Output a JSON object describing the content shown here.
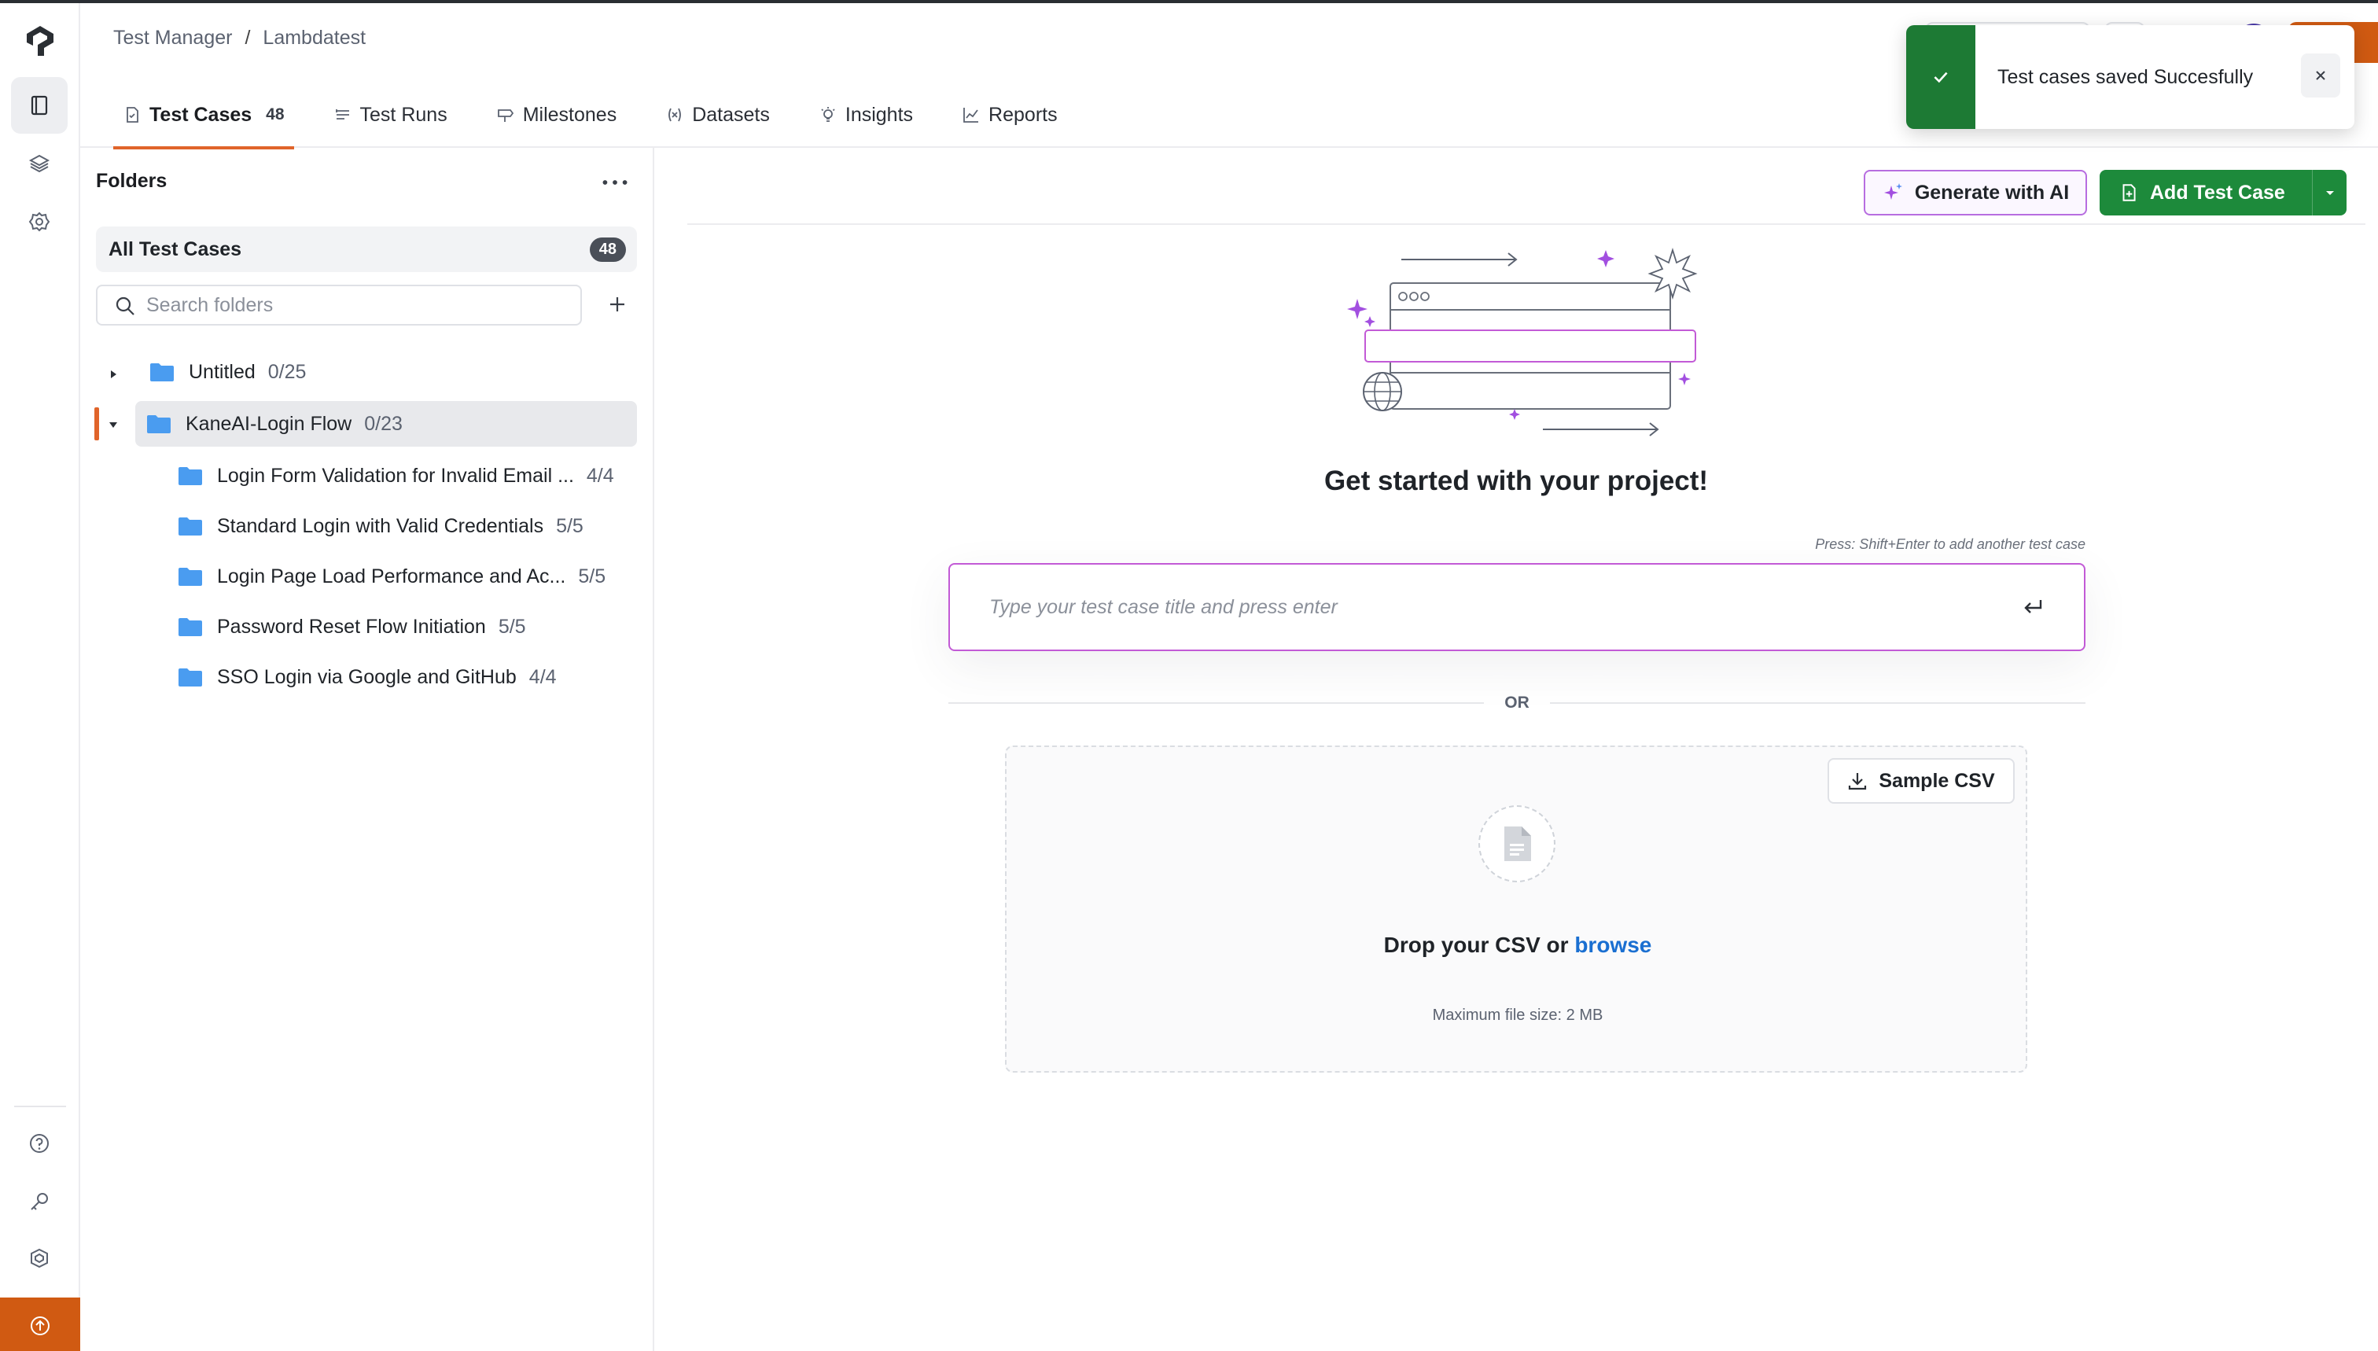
{
  "breadcrumb": {
    "parent": "Test Manager",
    "separator": "/",
    "current": "Lambdatest"
  },
  "tabs": [
    {
      "label": "Test Cases",
      "count": "48",
      "icon": "test-case-icon",
      "active": true
    },
    {
      "label": "Test Runs",
      "icon": "test-runs-icon"
    },
    {
      "label": "Milestones",
      "icon": "milestone-icon"
    },
    {
      "label": "Datasets",
      "icon": "dataset-icon"
    },
    {
      "label": "Insights",
      "icon": "insights-icon"
    },
    {
      "label": "Reports",
      "icon": "reports-icon"
    }
  ],
  "toast": {
    "message": "Test cases saved Succesfully",
    "status_color": "#1d7a34"
  },
  "folders": {
    "title": "Folders",
    "all_label": "All Test Cases",
    "all_count": "48",
    "search_placeholder": "Search folders",
    "tree": [
      {
        "name": "Untitled",
        "count": "0/25",
        "expanded": false
      },
      {
        "name": "KaneAI-Login Flow",
        "count": "0/23",
        "expanded": true,
        "selected": true
      },
      {
        "name": "Login Form Validation for Invalid Email ...",
        "count": "4/4"
      },
      {
        "name": "Standard Login with Valid Credentials",
        "count": "5/5"
      },
      {
        "name": "Login Page Load Performance and Ac...",
        "count": "5/5"
      },
      {
        "name": "Password Reset Flow Initiation",
        "count": "5/5"
      },
      {
        "name": "SSO Login via Google and GitHub",
        "count": "4/4"
      }
    ]
  },
  "main": {
    "generate_ai_label": "Generate with AI",
    "add_test_case_label": "Add Test Case",
    "headline": "Get started with your project!",
    "hint": "Press: Shift+Enter to add another test case",
    "input_placeholder": "Type your test case title and press enter",
    "or_label": "OR",
    "sample_csv_label": "Sample CSV",
    "drop_text": "Drop your CSV or",
    "browse_label": "browse",
    "max_size": "Maximum file size: 2 MB"
  },
  "colors": {
    "accent_orange": "#e0642a",
    "primary_green": "#1d8a3b",
    "ai_purple": "#b76de0",
    "link_blue": "#1a6fd1",
    "folder_blue": "#4a9cf0"
  }
}
